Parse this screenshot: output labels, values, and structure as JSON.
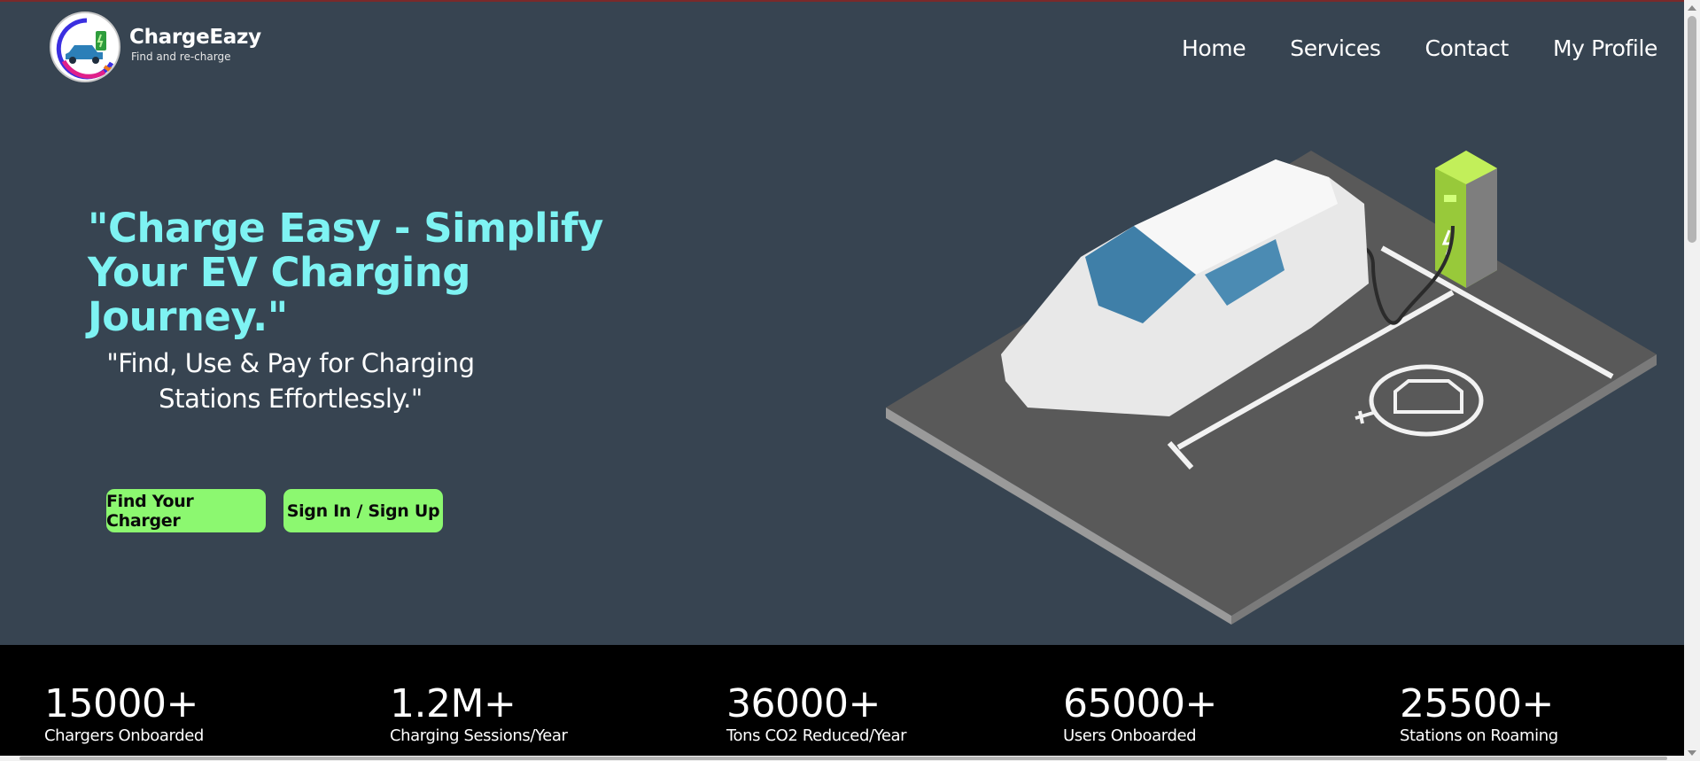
{
  "brand": {
    "name": "ChargeEazy",
    "tagline": "Find and re-charge"
  },
  "nav": {
    "items": [
      {
        "label": "Home"
      },
      {
        "label": "Services"
      },
      {
        "label": "Contact"
      },
      {
        "label": "My Profile"
      }
    ]
  },
  "hero": {
    "title_line1": "\"Charge Easy - Simplify",
    "title_line2": "Your EV Charging Journey.\"",
    "subtitle_line1": "\"Find, Use & Pay for Charging",
    "subtitle_line2": "Stations Effortlessly.\"",
    "primary_button": "Find Your Charger",
    "secondary_button": "Sign In / Sign Up",
    "illustration": "ev-car-charging-station-illustration"
  },
  "stats": [
    {
      "value": "15000+",
      "label": "Chargers Onboarded"
    },
    {
      "value": "1.2M+",
      "label": "Charging Sessions/Year"
    },
    {
      "value": "36000+",
      "label": "Tons CO2 Reduced/Year"
    },
    {
      "value": "65000+",
      "label": "Users Onboarded"
    },
    {
      "value": "25500+",
      "label": "Stations on Roaming"
    }
  ],
  "colors": {
    "background": "#374451",
    "headline": "#7ef3f3",
    "button": "#8cf870",
    "stats_band": "#000000"
  }
}
